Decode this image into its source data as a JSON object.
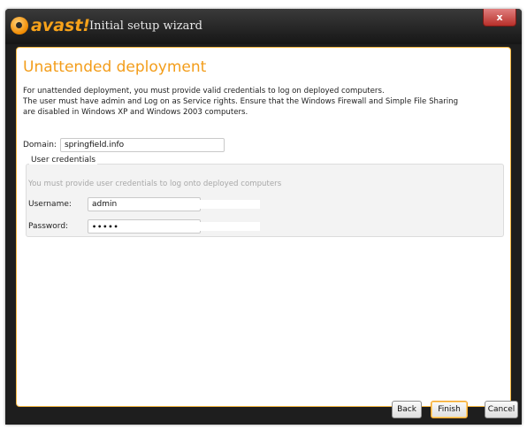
{
  "window": {
    "brand": "avast!",
    "title": "Initial setup wizard",
    "close_label": "x"
  },
  "page": {
    "heading": "Unattended deployment",
    "description_lines": [
      "For unattended deployment, you must provide valid credentials to log on deployed computers.",
      "The user must have admin and Log on as Service rights. Ensure that the Windows Firewall and Simple File Sharing",
      "are disabled in Windows XP and Windows 2003 computers."
    ]
  },
  "domain": {
    "label": "Domain:",
    "value": "springfield.info"
  },
  "credentials": {
    "legend": "User credentials",
    "hint": "You must provide user credentials to log onto deployed computers",
    "username_label": "Username:",
    "username_value": "admin",
    "password_label": "Password:",
    "password_value": "•••••"
  },
  "buttons": {
    "back": "Back",
    "finish": "Finish",
    "cancel": "Cancel"
  },
  "colors": {
    "accent": "#f39d1a",
    "titlebar": "#1e1e1e",
    "close": "#c0392b"
  }
}
